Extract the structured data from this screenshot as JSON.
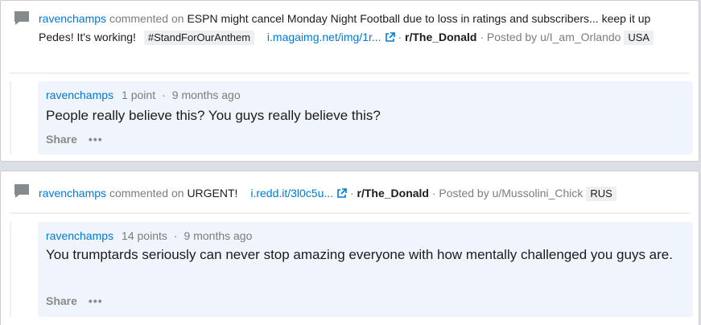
{
  "posts": [
    {
      "author": "ravenchamps",
      "commented_on": "commented on",
      "post_title": "ESPN might cancel Monday Night Football due to loss in ratings and subscribers... keep it up Pedes! It's working!",
      "post_flair": "#StandForOurAnthem",
      "link_text": "i.magaimg.net/img/1r...",
      "separator": "·",
      "subreddit": "r/The_Donald",
      "posted_by": "· Posted by",
      "op": "u/I_am_Orlando",
      "op_flair": "USA",
      "reply": {
        "author": "ravenchamps",
        "points": "1 point",
        "dot": "·",
        "time": "9 months ago",
        "text": "People really believe this? You guys really believe this?",
        "share": "Share",
        "more": "•••"
      }
    },
    {
      "author": "ravenchamps",
      "commented_on": "commented on",
      "post_title": "URGENT!",
      "link_text": "i.redd.it/3l0c5u...",
      "separator": "·",
      "subreddit": "r/The_Donald",
      "posted_by": "· Posted by",
      "op": "u/Mussolini_Chick",
      "op_flair": "RUS",
      "reply": {
        "author": "ravenchamps",
        "points": "14 points",
        "dot": "·",
        "time": "9 months ago",
        "text": "You trumptards seriously can never stop amazing everyone with how mentally challenged you guys are.",
        "share": "Share",
        "more": "•••"
      }
    }
  ],
  "colors": {
    "accent": "#0079d3",
    "reply_bg": "#f0f4fc",
    "page_bg": "#dae0e6"
  },
  "icons": [
    "comment-icon",
    "external-link-icon"
  ]
}
